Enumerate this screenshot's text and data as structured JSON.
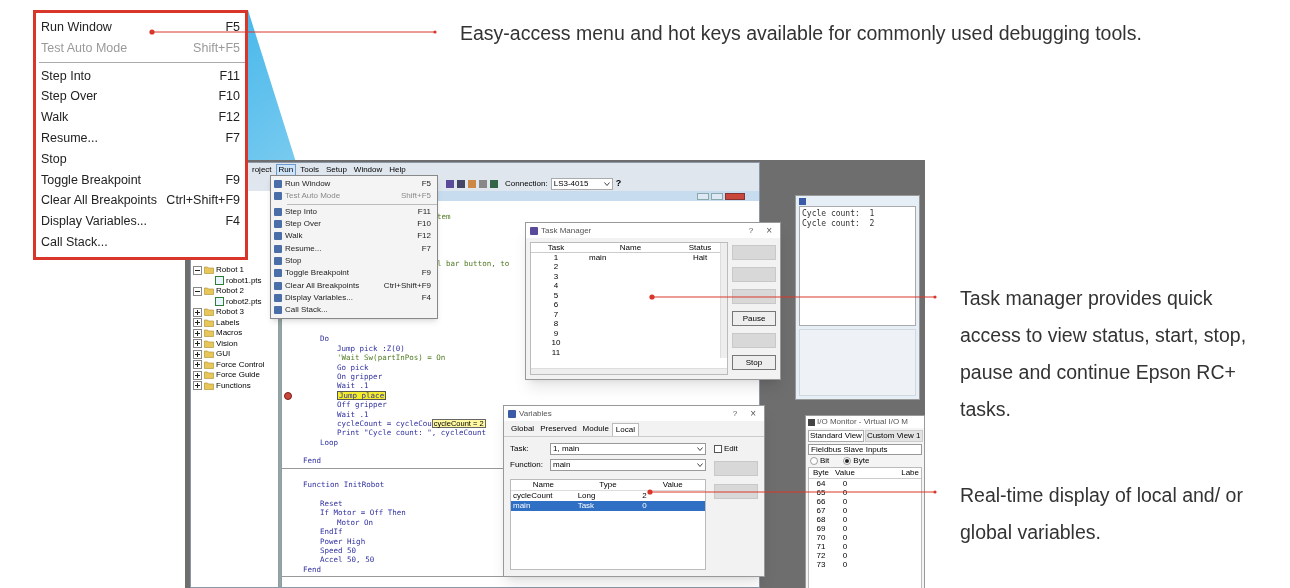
{
  "zoomed_menu": {
    "items": [
      {
        "kind": "item",
        "label": "Run Window",
        "shortcut": "F5",
        "disabled": false
      },
      {
        "kind": "item",
        "label": "Test Auto Mode",
        "shortcut": "Shift+F5",
        "disabled": true
      },
      {
        "kind": "separator"
      },
      {
        "kind": "item",
        "label": "Step Into",
        "shortcut": "F11",
        "disabled": false
      },
      {
        "kind": "item",
        "label": "Step Over",
        "shortcut": "F10",
        "disabled": false
      },
      {
        "kind": "item",
        "label": "Walk",
        "shortcut": "F12",
        "disabled": false
      },
      {
        "kind": "item",
        "label": "Resume...",
        "shortcut": "F7",
        "disabled": false
      },
      {
        "kind": "item",
        "label": "Stop",
        "disabled": false
      },
      {
        "kind": "item",
        "label": "Toggle Breakpoint",
        "shortcut": "F9",
        "disabled": false
      },
      {
        "kind": "item",
        "label": "Clear All Breakpoints",
        "shortcut": "Ctrl+Shift+F9",
        "disabled": false
      },
      {
        "kind": "item",
        "label": "Display Variables...",
        "shortcut": "F4",
        "disabled": false
      },
      {
        "kind": "item",
        "label": "Call Stack...",
        "disabled": false
      }
    ]
  },
  "callouts": [
    {
      "text": "Easy-access menu and hot keys available for commonly used debugging tools."
    },
    {
      "text": "Task manager provides quick access to view status, start, stop, pause and continue Epson RC+ tasks."
    },
    {
      "text": "Real-time display of local and/ or global variables."
    }
  ],
  "app": {
    "menu_bar": [
      {
        "label": "roject",
        "selected": false
      },
      {
        "label": "Run",
        "selected": true
      },
      {
        "label": "Tools",
        "selected": false
      },
      {
        "label": "Setup",
        "selected": false
      },
      {
        "label": "Window",
        "selected": false
      },
      {
        "label": "Help",
        "selected": false
      }
    ],
    "toolbar": {
      "connection_label": "Connection:",
      "connection_value": "LS3-4015",
      "help": "?"
    },
    "tree": [
      {
        "kind": "folder",
        "label": "Robot 1",
        "expanded": true,
        "children": [
          {
            "kind": "file",
            "label": "robot1.pts"
          }
        ]
      },
      {
        "kind": "folder",
        "label": "Robot 2",
        "expanded": true,
        "children": [
          {
            "kind": "file",
            "label": "robot2.pts"
          }
        ]
      },
      {
        "kind": "folder",
        "label": "Robot 3",
        "expanded": false
      },
      {
        "kind": "folder",
        "label": "Labels",
        "expanded": false
      },
      {
        "kind": "folder",
        "label": "Macros",
        "expanded": false
      },
      {
        "kind": "folder",
        "label": "Vision",
        "expanded": false
      },
      {
        "kind": "folder",
        "label": "GUI",
        "expanded": false
      },
      {
        "kind": "folder",
        "label": "Force Control",
        "expanded": false
      },
      {
        "kind": "folder",
        "label": "Force Guide",
        "expanded": false
      },
      {
        "kind": "folder",
        "label": "Functions",
        "expanded": false
      }
    ],
    "run_menu": {
      "items": [
        {
          "kind": "item",
          "label": "Run Window",
          "shortcut": "F5",
          "disabled": false
        },
        {
          "kind": "item",
          "label": "Test Auto Mode",
          "shortcut": "Shift+F5",
          "disabled": true
        },
        {
          "kind": "separator"
        },
        {
          "kind": "item",
          "label": "Step Into",
          "shortcut": "F11",
          "disabled": false
        },
        {
          "kind": "item",
          "label": "Step Over",
          "shortcut": "F10",
          "disabled": false
        },
        {
          "kind": "item",
          "label": "Walk",
          "shortcut": "F12",
          "disabled": false
        },
        {
          "kind": "item",
          "label": "Resume...",
          "shortcut": "F7",
          "disabled": false
        },
        {
          "kind": "item",
          "label": "Stop",
          "disabled": false
        },
        {
          "kind": "item",
          "label": "Toggle Breakpoint",
          "shortcut": "F9",
          "disabled": false
        },
        {
          "kind": "item",
          "label": "Clear All Breakpoints",
          "shortcut": "Ctrl+Shift+F9",
          "disabled": false
        },
        {
          "kind": "item",
          "label": "Display Variables...",
          "shortcut": "F4",
          "disabled": false
        },
        {
          "kind": "item",
          "label": "Call Stack...",
          "disabled": false
        }
      ]
    },
    "editor": {
      "lines": [
        {
          "kind": "group",
          "children": [
            {
              "kind": "blank"
            },
            {
              "kind": "partial",
              "text": "tem",
              "breakpoint": false,
              "highlighted": false
            },
            {
              "kind": "blank"
            },
            {
              "kind": "blank"
            },
            {
              "kind": "blank"
            },
            {
              "kind": "blank"
            },
            {
              "kind": "partial",
              "text": "l bar button, to",
              "breakpoint": false,
              "highlighted": false
            },
            {
              "kind": "blank"
            },
            {
              "kind": "blank"
            },
            {
              "kind": "blank"
            },
            {
              "kind": "blank"
            },
            {
              "kind": "blank"
            },
            {
              "kind": "blank"
            },
            {
              "kind": "blank"
            },
            {
              "kind": "code",
              "text": "Do",
              "breakpoint": false,
              "highlighted": false,
              "children": [
                {
                  "kind": "code",
                  "text": "Jump pick :Z(0)",
                  "breakpoint": false,
                  "highlighted": false
                },
                {
                  "kind": "comment",
                  "text": "'Wait Sw(partInPos) = On",
                  "breakpoint": false,
                  "highlighted": false
                },
                {
                  "kind": "code",
                  "text": "Go pick",
                  "breakpoint": false,
                  "highlighted": false
                },
                {
                  "kind": "code",
                  "text": "On gripper",
                  "breakpoint": false,
                  "highlighted": false
                },
                {
                  "kind": "code",
                  "text": "Wait .1",
                  "breakpoint": false,
                  "highlighted": false
                },
                {
                  "kind": "code",
                  "text": "Jump place",
                  "breakpoint": true,
                  "highlighted": true
                },
                {
                  "kind": "code",
                  "text": "Off gripper",
                  "breakpoint": false,
                  "highlighted": false
                },
                {
                  "kind": "code",
                  "text": "Wait .1",
                  "breakpoint": false,
                  "highlighted": false
                },
                {
                  "kind": "code",
                  "text": "cycleCount = cycleCou",
                  "tooltip": "cycleCount = 2",
                  "breakpoint": false,
                  "highlighted": false
                },
                {
                  "kind": "code",
                  "text": "Print \"Cycle count: \", cycleCount",
                  "breakpoint": false,
                  "highlighted": false
                }
              ]
            },
            {
              "kind": "code",
              "text": "Loop",
              "breakpoint": false,
              "highlighted": false
            },
            {
              "kind": "blank"
            }
          ]
        },
        {
          "kind": "code",
          "text": "Fend",
          "breakpoint": false,
          "highlighted": false
        },
        {
          "kind": "rule"
        },
        {
          "kind": "blank"
        },
        {
          "kind": "code",
          "text": "Function InitRobot",
          "breakpoint": false,
          "highlighted": false,
          "children": [
            {
              "kind": "blank"
            },
            {
              "kind": "code",
              "text": "Reset",
              "breakpoint": false,
              "highlighted": false
            },
            {
              "kind": "code",
              "text": "If Motor = Off Then",
              "breakpoint": false,
              "highlighted": false,
              "children": [
                {
                  "kind": "code",
                  "text": "Motor On",
                  "breakpoint": false,
                  "highlighted": false
                }
              ]
            },
            {
              "kind": "code",
              "text": "EndIf",
              "breakpoint": false,
              "highlighted": false
            },
            {
              "kind": "code",
              "text": "Power High",
              "breakpoint": false,
              "highlighted": false
            },
            {
              "kind": "code",
              "text": "Speed 50",
              "breakpoint": false,
              "highlighted": false
            },
            {
              "kind": "code",
              "text": "Accel 50, 50",
              "breakpoint": false,
              "highlighted": false
            }
          ]
        },
        {
          "kind": "code",
          "text": "Fend",
          "breakpoint": false,
          "highlighted": false
        },
        {
          "kind": "rule"
        }
      ]
    },
    "task_manager": {
      "title": "Task Manager",
      "help": "?",
      "close": "×",
      "columns": [
        "Task",
        "Name",
        "Status"
      ],
      "rows": [
        [
          "1",
          "main",
          "Halt"
        ],
        [
          "2"
        ],
        [
          "3"
        ],
        [
          "4"
        ],
        [
          "5"
        ],
        [
          "6"
        ],
        [
          "7"
        ],
        [
          "8"
        ],
        [
          "9"
        ],
        [
          "10"
        ],
        [
          "11"
        ]
      ],
      "buttons": [
        {
          "disabled": true
        },
        {
          "disabled": true
        },
        {
          "disabled": true
        },
        {
          "label": "Pause",
          "disabled": false
        },
        {
          "disabled": true
        },
        {
          "label": "Stop",
          "disabled": false
        }
      ]
    },
    "variables": {
      "title": "Variables",
      "help": "?",
      "close": "×",
      "tabs": [
        {
          "label": "Global",
          "selected": false
        },
        {
          "label": "Preserved",
          "selected": false
        },
        {
          "label": "Module",
          "selected": false
        },
        {
          "label": "Local",
          "selected": true
        }
      ],
      "task_label": "Task:",
      "task_value": "1, main",
      "function_label": "Function:",
      "function_value": "main",
      "edit": {
        "label": "Edit",
        "checked": false
      },
      "columns": [
        "Name",
        "Type",
        "Value"
      ],
      "rows": [
        {
          "cells": [
            "cycleCount",
            "Long",
            "2"
          ],
          "selected": false
        },
        {
          "cells": [
            "main",
            "Task",
            "0"
          ],
          "selected": true
        }
      ],
      "buttons": [
        {
          "disabled": true
        },
        {
          "disabled": true
        }
      ]
    },
    "run_window": {
      "output": [
        "Cycle count:  1",
        "Cycle count:  2"
      ]
    },
    "io_monitor": {
      "title": "I/O Monitor - Virtual I/O M",
      "tabs": [
        {
          "label": "Standard View",
          "selected": true
        },
        {
          "label": "Custom View 1",
          "selected": false
        }
      ],
      "source": "Fieldbus Slave Inputs",
      "modes": [
        {
          "label": "Bit",
          "selected": false
        },
        {
          "label": "Byte",
          "selected": true
        }
      ],
      "columns": [
        "Byte",
        "Value",
        "Labe"
      ],
      "rows": [
        [
          "64",
          "0"
        ],
        [
          "65",
          "0"
        ],
        [
          "66",
          "0"
        ],
        [
          "67",
          "0"
        ],
        [
          "68",
          "0"
        ],
        [
          "69",
          "0"
        ],
        [
          "70",
          "0"
        ],
        [
          "71",
          "0"
        ],
        [
          "72",
          "0"
        ],
        [
          "73",
          "0"
        ]
      ]
    }
  }
}
